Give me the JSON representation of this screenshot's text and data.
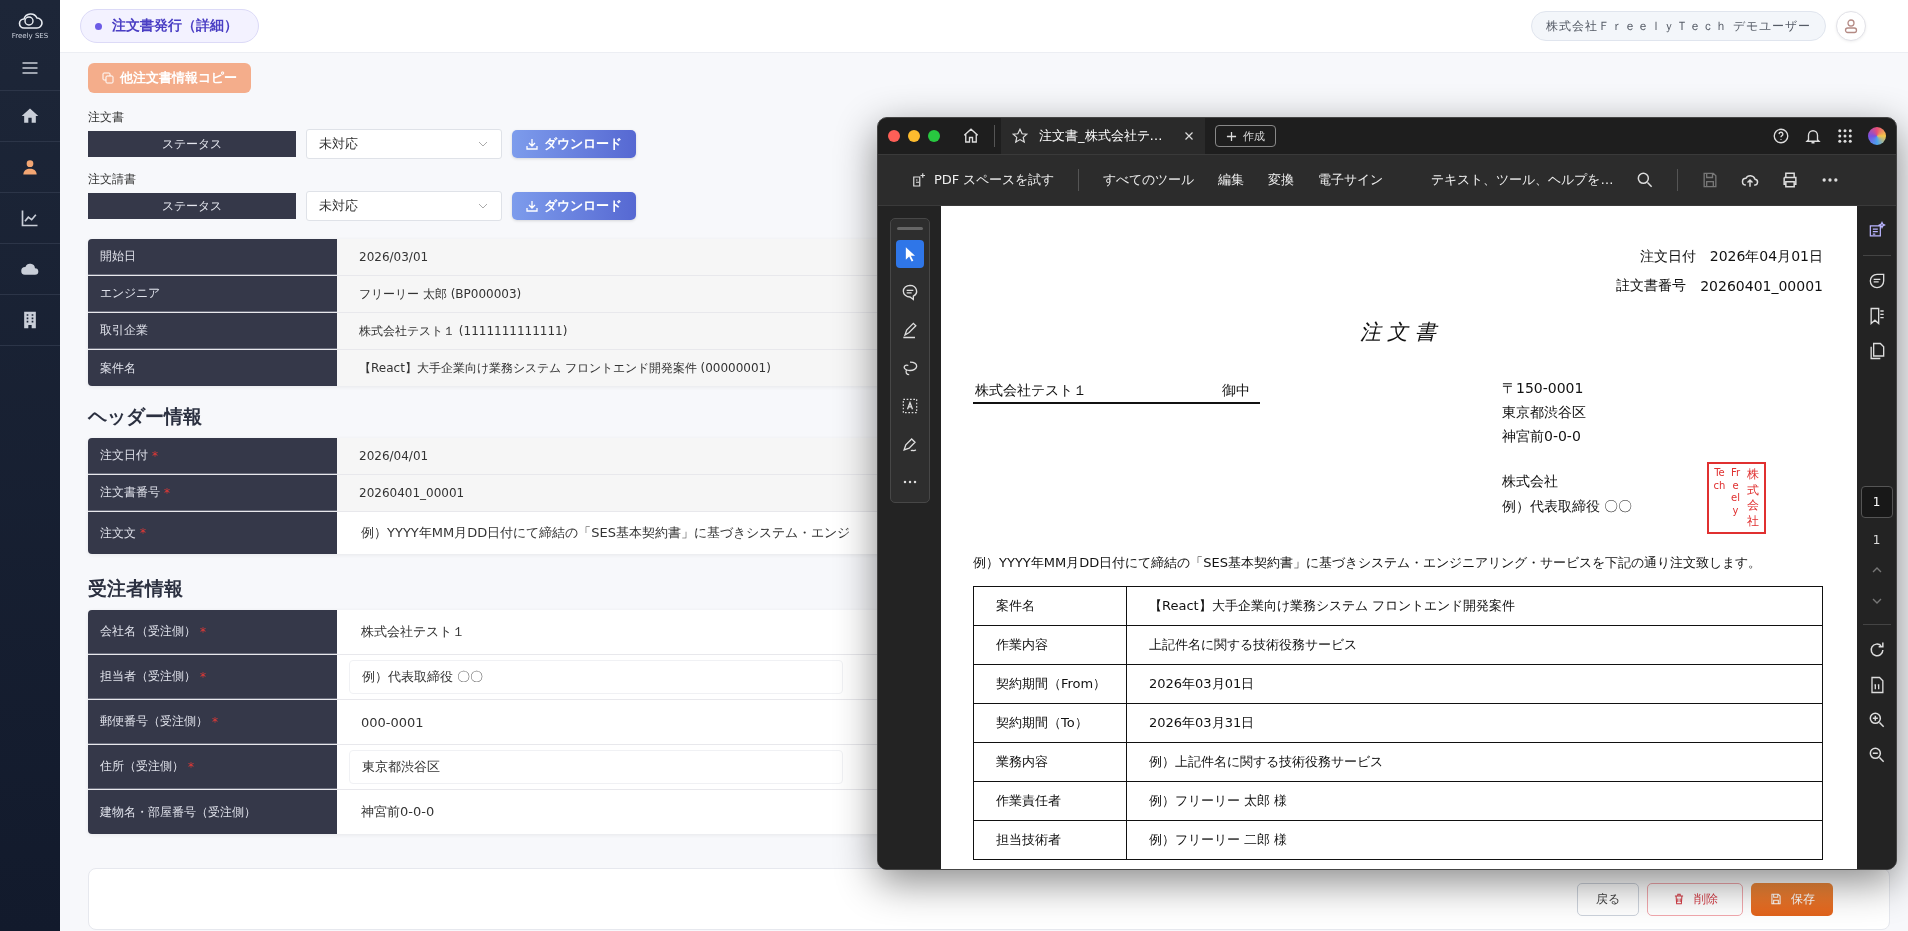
{
  "sidebar": {
    "logo_text": "Freely SES",
    "items": [
      {
        "kind": "menu",
        "selected": false
      },
      {
        "kind": "home",
        "selected": false
      },
      {
        "kind": "user",
        "selected": true
      },
      {
        "kind": "chart",
        "selected": false
      },
      {
        "kind": "cloud",
        "selected": false
      },
      {
        "kind": "building",
        "selected": false
      }
    ]
  },
  "header": {
    "breadcrumb": "注文書発行（詳細）",
    "user": "株式会社ＦｒｅｅｌｙＴｅｃｈ デモユーザー"
  },
  "copy_button": "他注文書情報コピー",
  "documents": [
    {
      "title": "注文書",
      "status_label": "ステータス",
      "status_value": "未対応",
      "download": "ダウンロード"
    },
    {
      "title": "注文請書",
      "status_label": "ステータス",
      "status_value": "未対応",
      "download": "ダウンロード"
    }
  ],
  "summary_table": [
    {
      "label": "開始日",
      "value": "2026/03/01"
    },
    {
      "label": "エンジニア",
      "value": "フリーリー 太郎 (BP000003)"
    },
    {
      "label": "取引企業",
      "value": "株式会社テスト１ (1111111111111)"
    },
    {
      "label": "案件名",
      "value": "【React】大手企業向け業務システム フロントエンド開発案件 (00000001)"
    }
  ],
  "header_section": {
    "title": "ヘッダー情報",
    "rows": [
      {
        "label": "注文日付",
        "required_mark": "*",
        "value": "2026/04/01"
      },
      {
        "label": "注文書番号",
        "required_mark": "*",
        "value": "20260401_00001"
      },
      {
        "label": "注文文",
        "required_mark": "*",
        "value": "例）YYYY年MM月DD日付にて締結の「SES基本契約書」に基づきシステム・エンジ"
      }
    ]
  },
  "orderer_section": {
    "title": "受注者情報",
    "rows": [
      {
        "label": "会社名（受注側）",
        "required_mark": "*",
        "value": "株式会社テスト１",
        "kind": "text"
      },
      {
        "label": "担当者（受注側）",
        "required_mark": "*",
        "value": "例）代表取締役 〇〇",
        "kind": "input"
      },
      {
        "label": "郵便番号（受注側）",
        "required_mark": "*",
        "value": "000-0001",
        "kind": "text"
      },
      {
        "label": "住所（受注側）",
        "required_mark": "*",
        "value": "東京都渋谷区",
        "kind": "input"
      },
      {
        "label": "建物名・部屋番号（受注側）",
        "value": "神宮前0-0-0",
        "kind": "text"
      }
    ]
  },
  "actions": [
    {
      "label": "戻る",
      "kind": "back"
    },
    {
      "label": "削除",
      "kind": "delete"
    },
    {
      "label": "保存",
      "kind": "save"
    }
  ],
  "pdf_viewer": {
    "tab_title": "注文書_株式会社テ…",
    "new_button": "作成",
    "toolbar": {
      "try_spaces": "PDF スペースを試す",
      "menu": [
        "すべてのツール",
        "編集",
        "変換",
        "電子サイン"
      ],
      "search_placeholder": "テキスト、ツール、ヘルプを…"
    },
    "tools": [
      {
        "kind": "select",
        "selected": true
      },
      {
        "kind": "comment",
        "selected": false
      },
      {
        "kind": "draw",
        "selected": false
      },
      {
        "kind": "lasso",
        "selected": false
      },
      {
        "kind": "text-select",
        "selected": false
      },
      {
        "kind": "sign",
        "selected": false
      },
      {
        "kind": "more",
        "selected": false
      }
    ],
    "page_indicator": {
      "current": "1",
      "total": "1"
    },
    "document": {
      "date_label": "注文日付",
      "date": "2026年04月01日",
      "number_label": "註文書番号",
      "number": "20260401_00001",
      "title": "注 文 書",
      "recipient": "株式会社テスト１",
      "honorific": "御中",
      "sender_address": [
        "〒150-0001",
        "東京都渋谷区",
        "神宮前0-0-0"
      ],
      "sender_company": "株式会社",
      "sender_rep": "例）代表取締役 〇〇",
      "seal": [
        "Tech",
        "Freely",
        "株式会社"
      ],
      "intro": "例）YYYY年MM月DD日付にて締結の「SES基本契約書」に基づきシステム・エンジニアリング・サービスを下記の通り注文致します。",
      "rows": [
        {
          "label": "案件名",
          "value": "【React】大手企業向け業務システム フロントエンド開発案件"
        },
        {
          "label": "作業内容",
          "value": "上記件名に関する技術役務サービス"
        },
        {
          "label": "契約期間（From）",
          "value": "2026年03月01日"
        },
        {
          "label": "契約期間（To）",
          "value": "2026年03月31日"
        },
        {
          "label": "業務内容",
          "value": "例）上記件名に関する技術役務サービス"
        },
        {
          "label": "作業責任者",
          "value": "例）フリーリー 太郎 様"
        },
        {
          "label": "担当技術者",
          "value": "例）フリーリー 二郎 様"
        }
      ]
    }
  }
}
